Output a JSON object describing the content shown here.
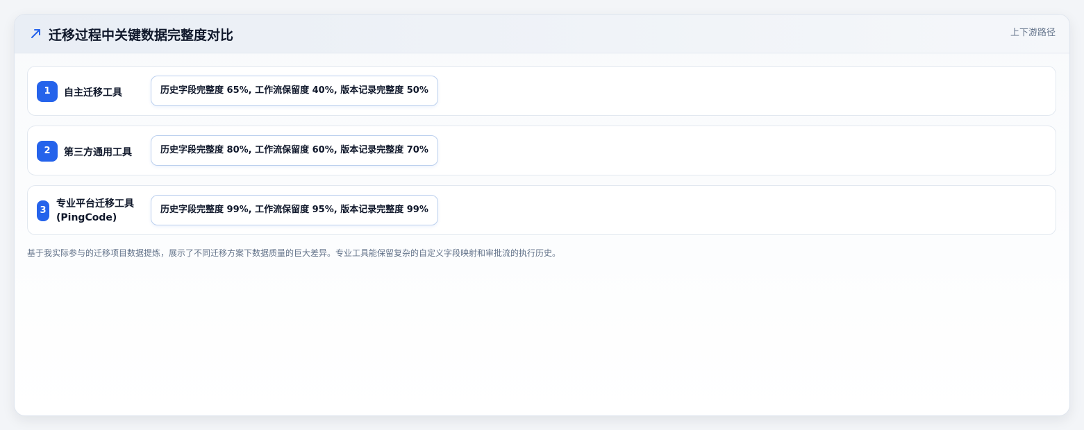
{
  "header": {
    "icon": "trend-arrow-icon",
    "title": "迁移过程中关键数据完整度对比",
    "link": "上下游路径"
  },
  "rows": [
    {
      "number": "1",
      "tool": "自主迁移工具",
      "metrics": "历史字段完整度 65%, 工作流保留度 40%, 版本记录完整度 50%"
    },
    {
      "number": "2",
      "tool": "第三方通用工具",
      "metrics": "历史字段完整度 80%, 工作流保留度 60%, 版本记录完整度 70%"
    },
    {
      "number": "3",
      "tool_line1": "专业平台迁移工具",
      "tool_line2": "(PingCode)",
      "metrics": "历史字段完整度 99%, 工作流保留度 95%, 版本记录完整度 99%"
    }
  ],
  "note": "基于我实际参与的迁移项目数据提炼，展示了不同迁移方案下数据质量的巨大差异。专业工具能保留复杂的自定义字段映射和审批流的执行历史。",
  "colors": {
    "accent": "#2563eb",
    "title": "#0f172a",
    "muted": "#64748b"
  }
}
